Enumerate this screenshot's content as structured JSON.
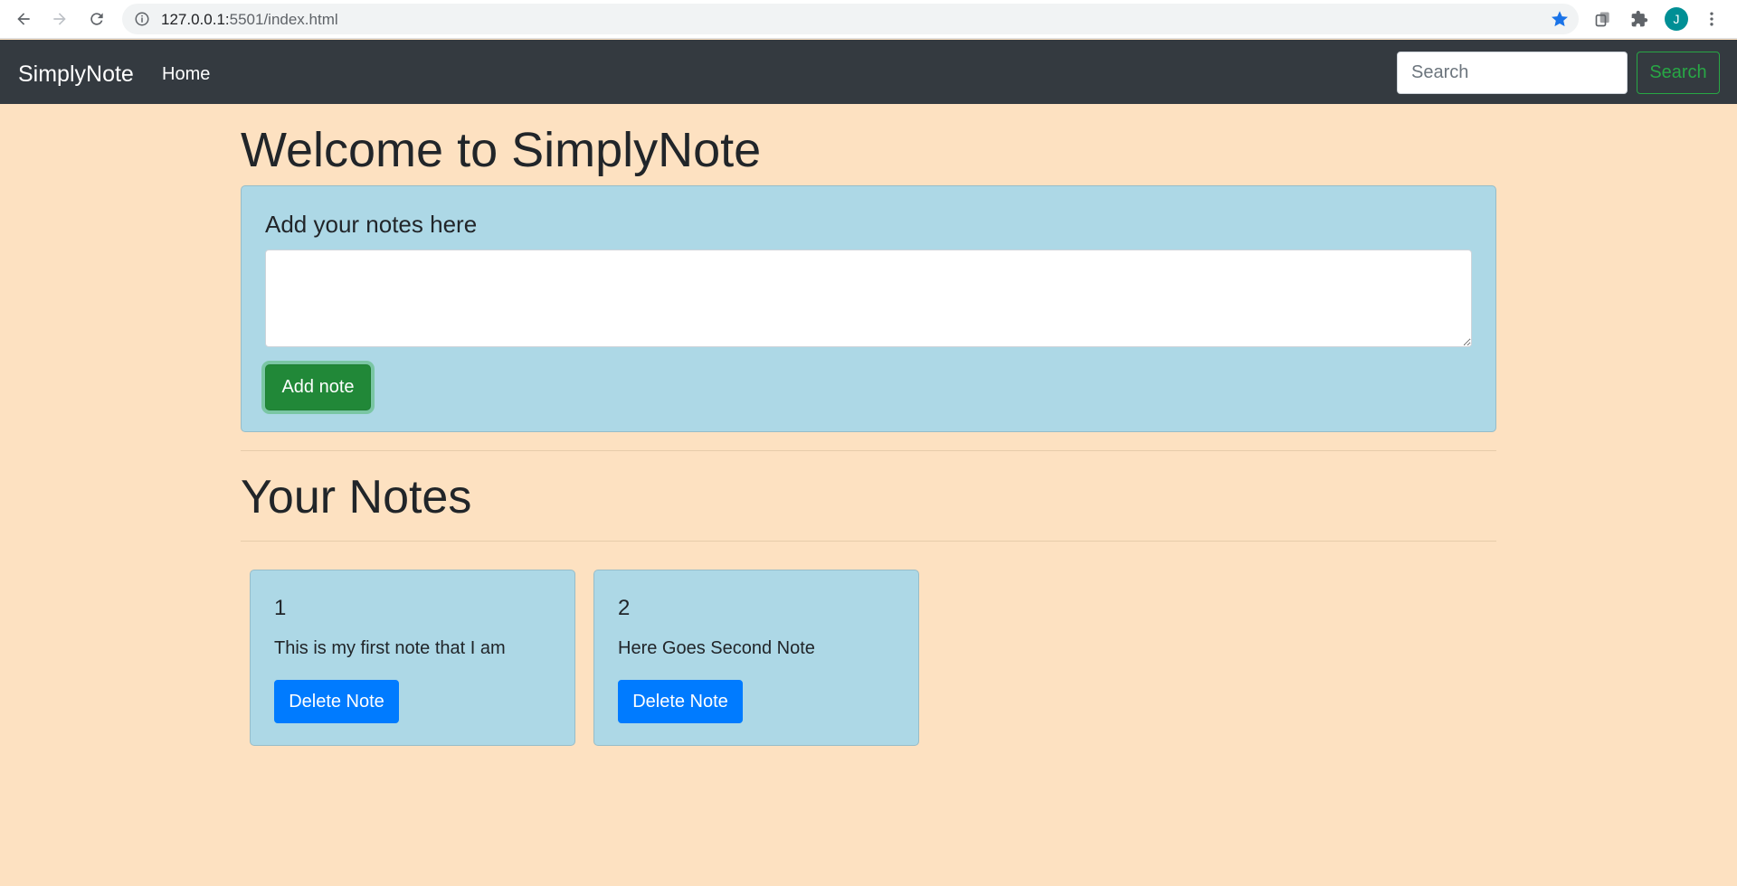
{
  "browser": {
    "url_host": "127.0.0.1:",
    "url_path": "5501/index.html",
    "profile_initial": "J"
  },
  "navbar": {
    "brand": "SimplyNote",
    "home_label": "Home",
    "search_placeholder": "Search",
    "search_button": "Search"
  },
  "main": {
    "title": "Welcome to SimplyNote",
    "add_card": {
      "heading": "Add your notes here",
      "textarea_value": "",
      "add_button": "Add note"
    },
    "notes_heading": "Your Notes",
    "notes": [
      {
        "title": "1",
        "text": "This is my first note that I am",
        "delete_label": "Delete Note"
      },
      {
        "title": "2",
        "text": "Here Goes Second Note",
        "delete_label": "Delete Note"
      }
    ]
  },
  "colors": {
    "page_background": "#fde1c1",
    "card_background": "#add8e6",
    "navbar_background": "#343a40",
    "success": "#28a745",
    "primary": "#007bff"
  },
  "icons": [
    "back-icon",
    "forward-icon",
    "reload-icon",
    "info-icon",
    "star-icon",
    "extension-icon",
    "puzzle-icon",
    "kebab-menu-icon"
  ]
}
